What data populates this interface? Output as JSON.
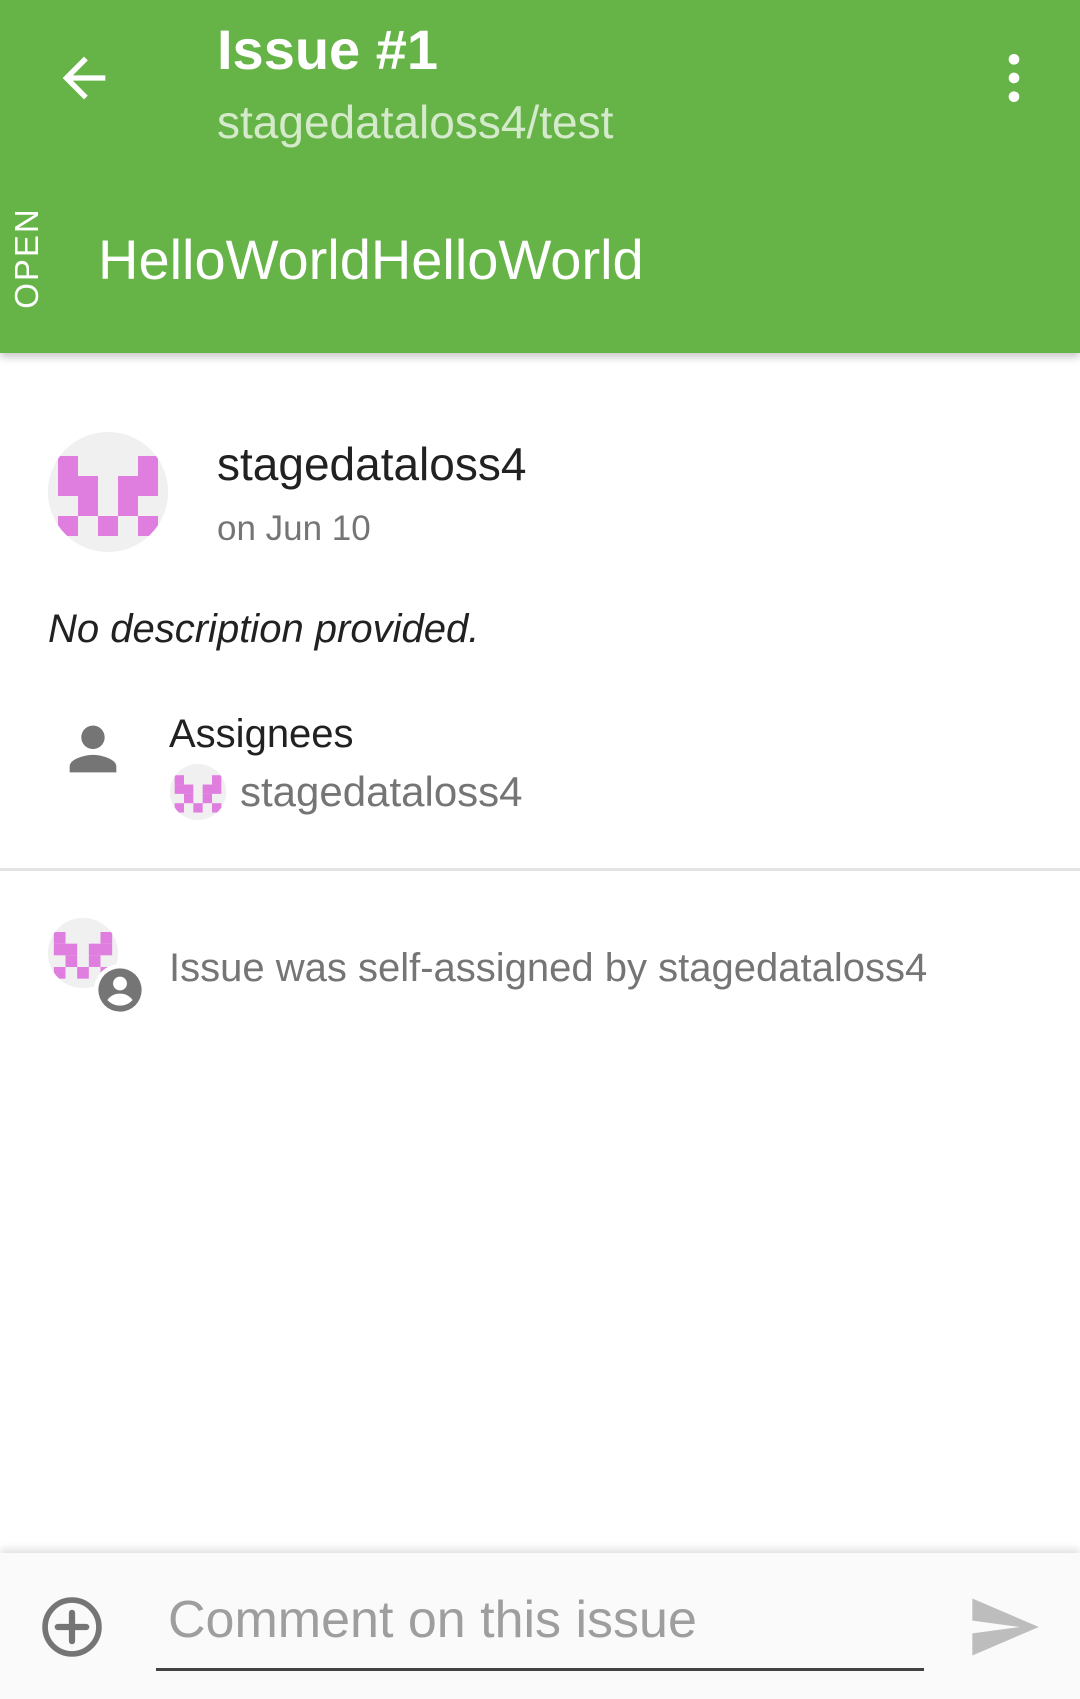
{
  "header": {
    "title": "Issue #1",
    "repository": "stagedataloss4/test",
    "state": "OPEN",
    "issue_title": "HelloWorldHelloWorld",
    "icons": {
      "back": "arrow-back-icon",
      "more": "more-vert-icon"
    }
  },
  "issue": {
    "author": "stagedataloss4",
    "date": "on Jun 10",
    "description": "No description provided.",
    "assignees_label": "Assignees",
    "assignees": [
      {
        "name": "stagedataloss4"
      }
    ]
  },
  "events": [
    {
      "text": "Issue was self-assigned by stagedataloss4",
      "icon": "account-circle-icon"
    }
  ],
  "comment_bar": {
    "placeholder": "Comment on this issue",
    "icons": {
      "add": "add-circle-icon",
      "send": "send-icon"
    }
  },
  "colors": {
    "header_green": "#66b447",
    "avatar_pink": "#e07ee0",
    "avatar_bg": "#f0f0f0",
    "secondary_text": "#757575",
    "icon_gray": "#757575"
  }
}
